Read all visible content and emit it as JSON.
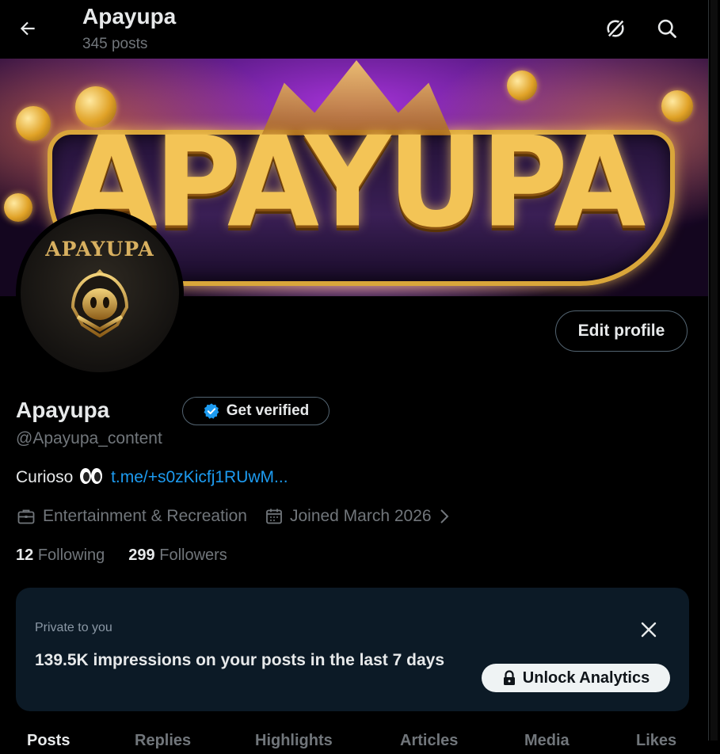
{
  "header": {
    "title": "Apayupa",
    "posts_count": "345 posts"
  },
  "banner": {
    "text": "APAYUPA"
  },
  "avatar": {
    "text": "APAYUPA"
  },
  "profile": {
    "name": "Apayupa",
    "handle": "@Apayupa_content",
    "get_verified_label": "Get verified",
    "edit_profile_label": "Edit profile",
    "bio_text": "Curioso",
    "bio_link": "t.me/+s0zKicfj1RUwM...",
    "category": "Entertainment & Recreation",
    "joined": "Joined March 2026",
    "following_count": "12",
    "following_label": "Following",
    "followers_count": "299",
    "followers_label": "Followers"
  },
  "analytics_card": {
    "private_label": "Private to you",
    "impressions_text": "139.5K impressions on your posts in the last 7 days",
    "unlock_label": "Unlock Analytics"
  },
  "tabs": [
    {
      "label": "Posts"
    },
    {
      "label": "Replies"
    },
    {
      "label": "Highlights"
    },
    {
      "label": "Articles"
    },
    {
      "label": "Media"
    },
    {
      "label": "Likes"
    }
  ],
  "colors": {
    "background": "#000000",
    "primary_text": "#e7e9ea",
    "secondary_text": "#71767b",
    "link": "#1d9bf0",
    "verified_badge": "#1d9bf0",
    "card_background": "#0c1a26"
  },
  "icons": {
    "back": "arrow-left-icon",
    "grok": "grok-icon",
    "search": "search-icon",
    "verified": "verified-badge-icon",
    "briefcase": "briefcase-icon",
    "calendar": "calendar-icon",
    "chevron": "chevron-right-icon",
    "close": "close-icon",
    "lock": "lock-icon"
  }
}
